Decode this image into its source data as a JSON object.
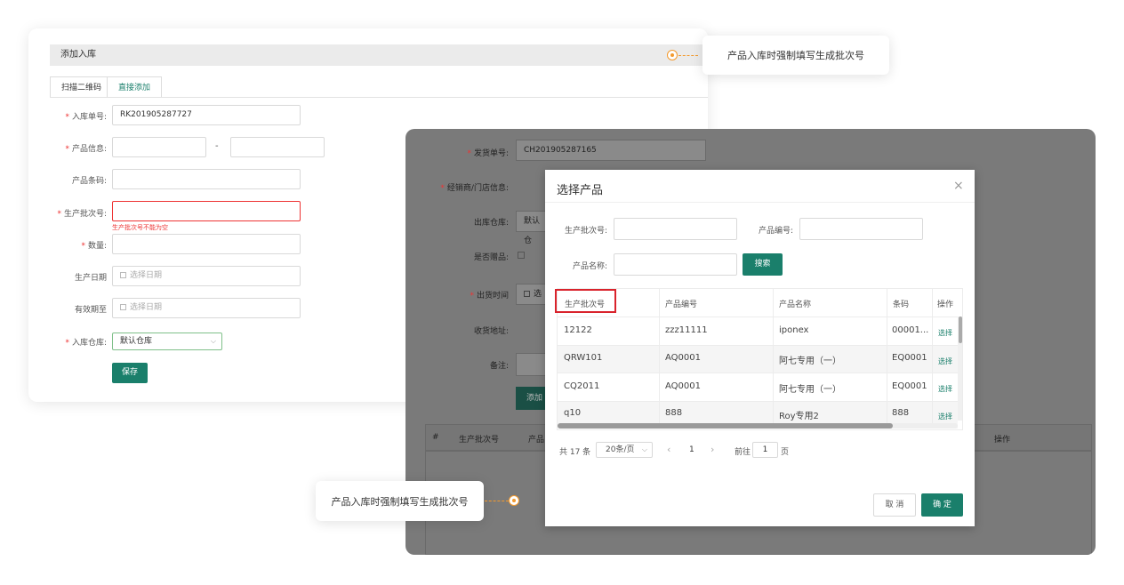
{
  "left_form": {
    "title": "添加入库",
    "tabs": [
      "扫描二维码",
      "直接添加"
    ],
    "fields": {
      "inbound_no": {
        "label": "入库单号:",
        "value": "RK201905287727"
      },
      "product_info": {
        "label": "产品信息:",
        "separator": "-"
      },
      "barcode": {
        "label": "产品条码:"
      },
      "batch_no": {
        "label": "生产批次号:",
        "error": "生产批次号不能为空"
      },
      "quantity": {
        "label": "数量:"
      },
      "prod_date": {
        "label": "生产日期",
        "placeholder": "选择日期"
      },
      "expiry": {
        "label": "有效期至",
        "placeholder": "选择日期"
      },
      "warehouse": {
        "label": "入库仓库:",
        "value": "默认仓库"
      }
    },
    "save_label": "保存"
  },
  "right_form": {
    "ship_no": {
      "label": "发货单号:",
      "value": "CH201905287165"
    },
    "dealer": {
      "label": "经销商/门店信息:"
    },
    "out_warehouse": {
      "label": "出库仓库:",
      "value": "默认仓"
    },
    "is_gift": {
      "label": "是否赠品:"
    },
    "out_time": {
      "label": "出货时间",
      "placeholder": "选"
    },
    "address": {
      "label": "收货地址:"
    },
    "remark": {
      "label": "备注:"
    },
    "add_btn": "添加",
    "table_headers": {
      "num": "#",
      "batch": "生产批次号",
      "product": "产品",
      "op": "操作"
    }
  },
  "modal": {
    "title": "选择产品",
    "close": "×",
    "filters": {
      "batch_label": "生产批次号:",
      "code_label": "产品编号:",
      "name_label": "产品名称:",
      "search_btn": "搜索"
    },
    "columns": [
      "生产批次号",
      "产品编号",
      "产品名称",
      "条码",
      "操作"
    ],
    "rows": [
      {
        "batch": "12122",
        "code": "zzz11111",
        "name": "iponex",
        "barcode": "00001...",
        "op": "选择"
      },
      {
        "batch": "QRW101",
        "code": "AQ0001",
        "name": "阿七专用（一）",
        "barcode": "EQ0001",
        "op": "选择"
      },
      {
        "batch": "CQ2011",
        "code": "AQ0001",
        "name": "阿七专用（一）",
        "barcode": "EQ0001",
        "op": "选择"
      },
      {
        "batch": "q10",
        "code": "888",
        "name": "Roy专用2",
        "barcode": "888",
        "op": "选择"
      }
    ],
    "pagination": {
      "total": "共 17 条",
      "page_size": "20条/页",
      "prev": "‹",
      "page": "1",
      "next": "›",
      "goto_label": "前往",
      "goto_value": "1",
      "goto_unit": "页"
    },
    "cancel": "取 消",
    "confirm": "确 定"
  },
  "callouts": {
    "top": "产品入库时强制填写生成批次号",
    "bottom": "产品入库时强制填写生成批次号"
  },
  "colors": {
    "accent": "#1a7f6b",
    "error": "#e33333",
    "callout": "#f39a2e"
  }
}
